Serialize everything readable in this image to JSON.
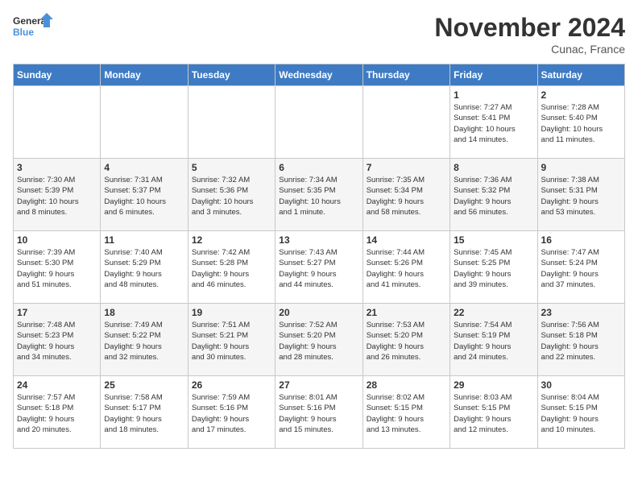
{
  "header": {
    "logo_general": "General",
    "logo_blue": "Blue",
    "month_title": "November 2024",
    "location": "Cunac, France"
  },
  "columns": [
    "Sunday",
    "Monday",
    "Tuesday",
    "Wednesday",
    "Thursday",
    "Friday",
    "Saturday"
  ],
  "weeks": [
    {
      "days": [
        {
          "num": "",
          "info": ""
        },
        {
          "num": "",
          "info": ""
        },
        {
          "num": "",
          "info": ""
        },
        {
          "num": "",
          "info": ""
        },
        {
          "num": "",
          "info": ""
        },
        {
          "num": "1",
          "info": "Sunrise: 7:27 AM\nSunset: 5:41 PM\nDaylight: 10 hours\nand 14 minutes."
        },
        {
          "num": "2",
          "info": "Sunrise: 7:28 AM\nSunset: 5:40 PM\nDaylight: 10 hours\nand 11 minutes."
        }
      ]
    },
    {
      "days": [
        {
          "num": "3",
          "info": "Sunrise: 7:30 AM\nSunset: 5:39 PM\nDaylight: 10 hours\nand 8 minutes."
        },
        {
          "num": "4",
          "info": "Sunrise: 7:31 AM\nSunset: 5:37 PM\nDaylight: 10 hours\nand 6 minutes."
        },
        {
          "num": "5",
          "info": "Sunrise: 7:32 AM\nSunset: 5:36 PM\nDaylight: 10 hours\nand 3 minutes."
        },
        {
          "num": "6",
          "info": "Sunrise: 7:34 AM\nSunset: 5:35 PM\nDaylight: 10 hours\nand 1 minute."
        },
        {
          "num": "7",
          "info": "Sunrise: 7:35 AM\nSunset: 5:34 PM\nDaylight: 9 hours\nand 58 minutes."
        },
        {
          "num": "8",
          "info": "Sunrise: 7:36 AM\nSunset: 5:32 PM\nDaylight: 9 hours\nand 56 minutes."
        },
        {
          "num": "9",
          "info": "Sunrise: 7:38 AM\nSunset: 5:31 PM\nDaylight: 9 hours\nand 53 minutes."
        }
      ]
    },
    {
      "days": [
        {
          "num": "10",
          "info": "Sunrise: 7:39 AM\nSunset: 5:30 PM\nDaylight: 9 hours\nand 51 minutes."
        },
        {
          "num": "11",
          "info": "Sunrise: 7:40 AM\nSunset: 5:29 PM\nDaylight: 9 hours\nand 48 minutes."
        },
        {
          "num": "12",
          "info": "Sunrise: 7:42 AM\nSunset: 5:28 PM\nDaylight: 9 hours\nand 46 minutes."
        },
        {
          "num": "13",
          "info": "Sunrise: 7:43 AM\nSunset: 5:27 PM\nDaylight: 9 hours\nand 44 minutes."
        },
        {
          "num": "14",
          "info": "Sunrise: 7:44 AM\nSunset: 5:26 PM\nDaylight: 9 hours\nand 41 minutes."
        },
        {
          "num": "15",
          "info": "Sunrise: 7:45 AM\nSunset: 5:25 PM\nDaylight: 9 hours\nand 39 minutes."
        },
        {
          "num": "16",
          "info": "Sunrise: 7:47 AM\nSunset: 5:24 PM\nDaylight: 9 hours\nand 37 minutes."
        }
      ]
    },
    {
      "days": [
        {
          "num": "17",
          "info": "Sunrise: 7:48 AM\nSunset: 5:23 PM\nDaylight: 9 hours\nand 34 minutes."
        },
        {
          "num": "18",
          "info": "Sunrise: 7:49 AM\nSunset: 5:22 PM\nDaylight: 9 hours\nand 32 minutes."
        },
        {
          "num": "19",
          "info": "Sunrise: 7:51 AM\nSunset: 5:21 PM\nDaylight: 9 hours\nand 30 minutes."
        },
        {
          "num": "20",
          "info": "Sunrise: 7:52 AM\nSunset: 5:20 PM\nDaylight: 9 hours\nand 28 minutes."
        },
        {
          "num": "21",
          "info": "Sunrise: 7:53 AM\nSunset: 5:20 PM\nDaylight: 9 hours\nand 26 minutes."
        },
        {
          "num": "22",
          "info": "Sunrise: 7:54 AM\nSunset: 5:19 PM\nDaylight: 9 hours\nand 24 minutes."
        },
        {
          "num": "23",
          "info": "Sunrise: 7:56 AM\nSunset: 5:18 PM\nDaylight: 9 hours\nand 22 minutes."
        }
      ]
    },
    {
      "days": [
        {
          "num": "24",
          "info": "Sunrise: 7:57 AM\nSunset: 5:18 PM\nDaylight: 9 hours\nand 20 minutes."
        },
        {
          "num": "25",
          "info": "Sunrise: 7:58 AM\nSunset: 5:17 PM\nDaylight: 9 hours\nand 18 minutes."
        },
        {
          "num": "26",
          "info": "Sunrise: 7:59 AM\nSunset: 5:16 PM\nDaylight: 9 hours\nand 17 minutes."
        },
        {
          "num": "27",
          "info": "Sunrise: 8:01 AM\nSunset: 5:16 PM\nDaylight: 9 hours\nand 15 minutes."
        },
        {
          "num": "28",
          "info": "Sunrise: 8:02 AM\nSunset: 5:15 PM\nDaylight: 9 hours\nand 13 minutes."
        },
        {
          "num": "29",
          "info": "Sunrise: 8:03 AM\nSunset: 5:15 PM\nDaylight: 9 hours\nand 12 minutes."
        },
        {
          "num": "30",
          "info": "Sunrise: 8:04 AM\nSunset: 5:15 PM\nDaylight: 9 hours\nand 10 minutes."
        }
      ]
    }
  ]
}
